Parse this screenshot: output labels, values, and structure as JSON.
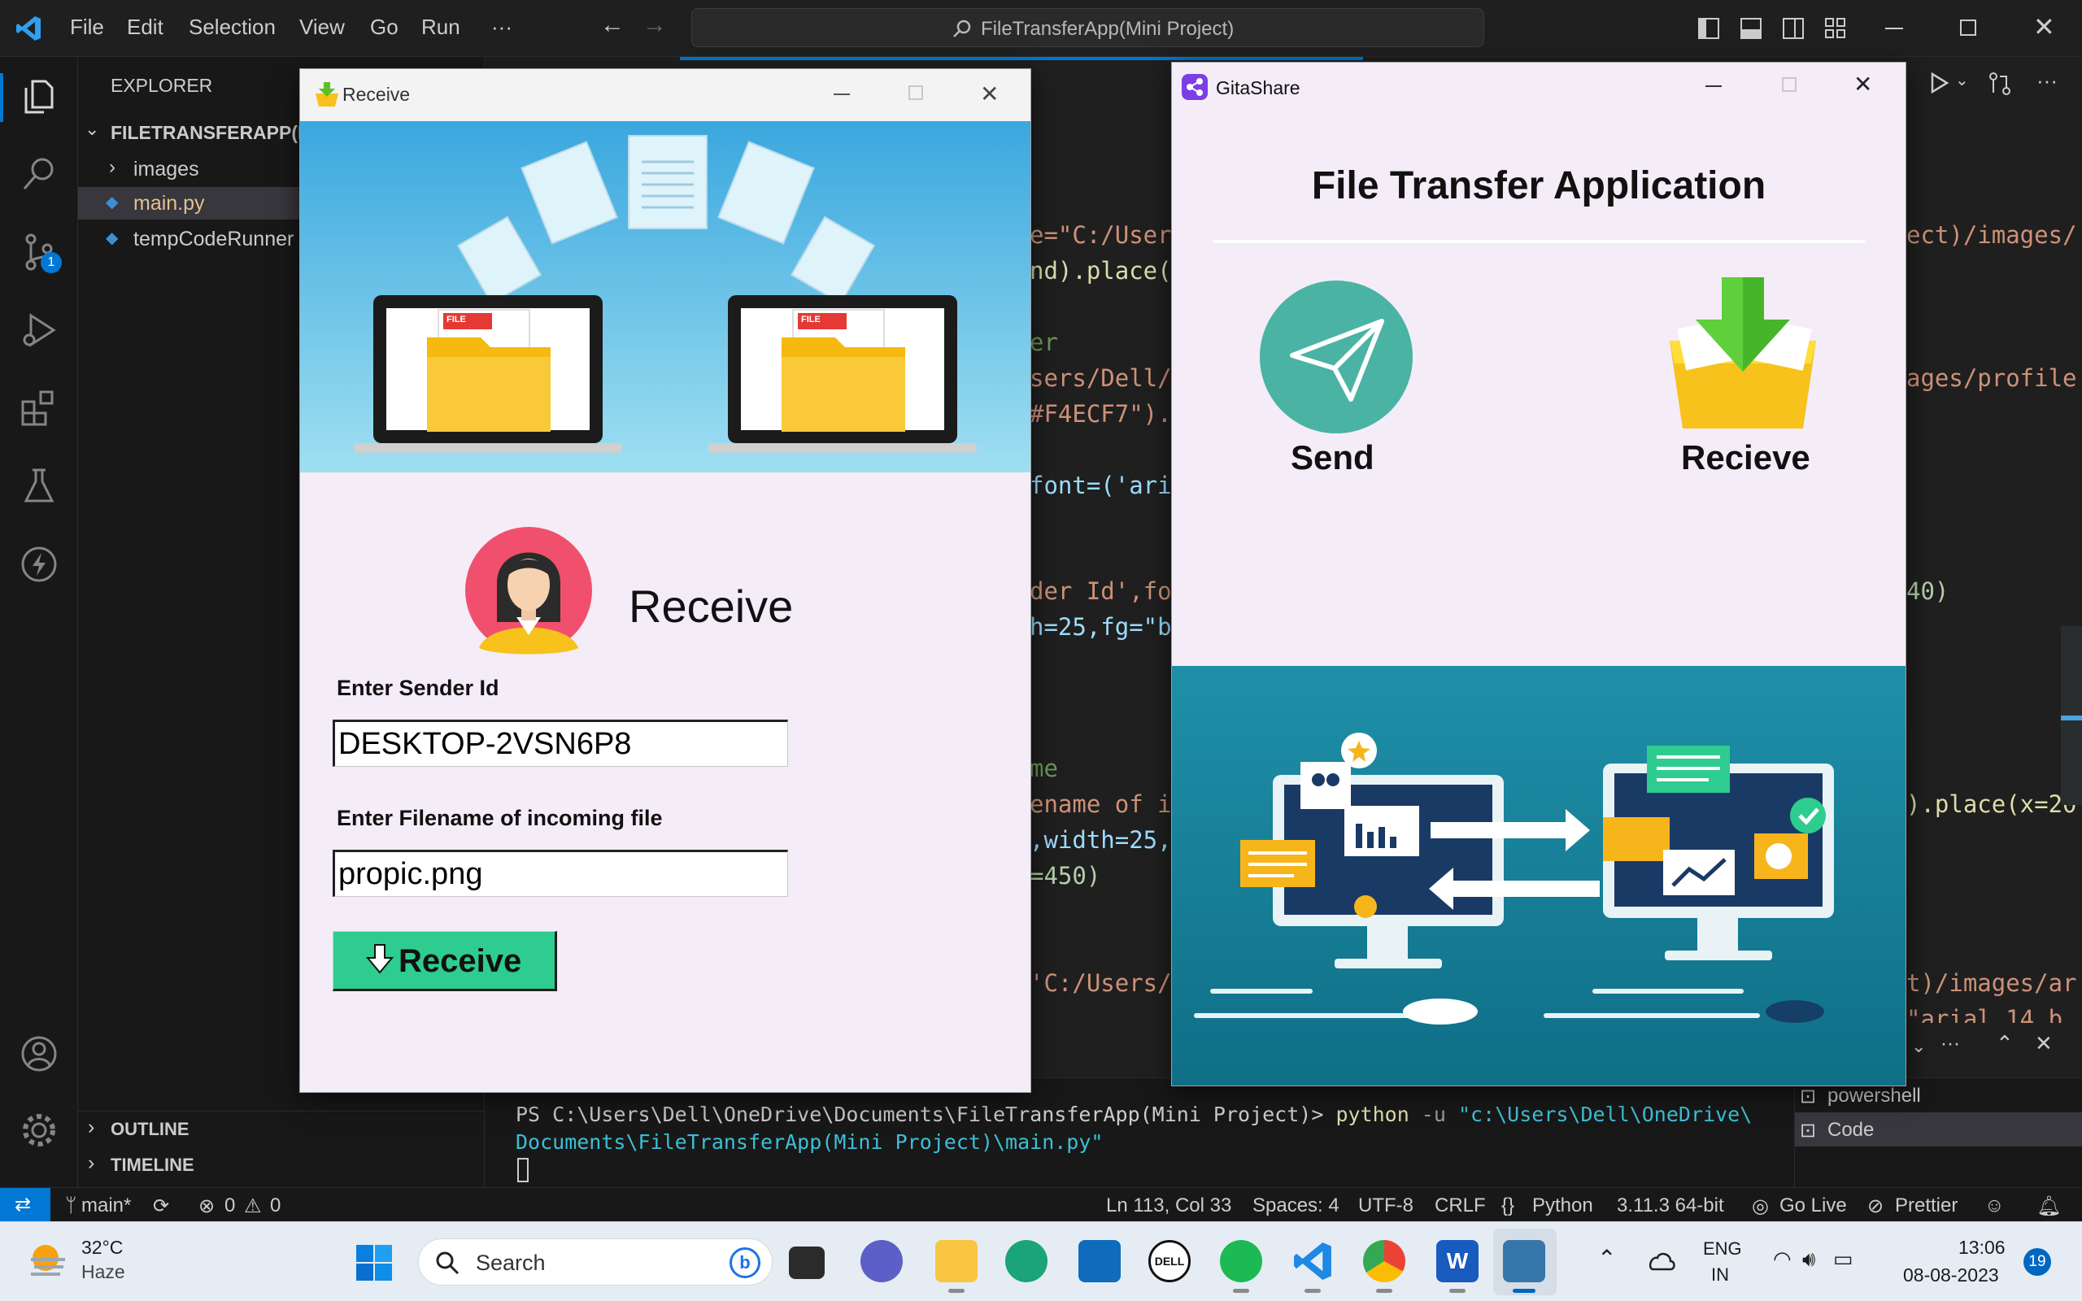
{
  "vscode": {
    "menu": [
      "File",
      "Edit",
      "Selection",
      "View",
      "Go",
      "Run",
      "···"
    ],
    "command_center": "FileTransferApp(Mini Project)",
    "activity_badge": "1",
    "explorer_label": "EXPLORER",
    "project_folder": "FILETRANSFERAPP(MI",
    "files": [
      "images",
      "main.py",
      "tempCodeRunner"
    ],
    "outline_label": "OUTLINE",
    "timeline_label": "TIMELINE",
    "code_fragments": {
      "l1a": "e=\"C:/User",
      "l1b": "ect)/images/",
      "l2": "nd).place(",
      "l3": "er",
      "l4a": "sers/Dell/",
      "l4b": "ages/profile",
      "l5": "#F4ECF7\").",
      "l6": "font=('ari",
      "l7a": "der Id',fo",
      "l7b": "40)",
      "l8": "h=25,fg=\"b",
      "l9": "me",
      "l10a": "ename of i",
      "l10b": ").place(x=20",
      "l11": ",width=25,",
      "l12": "=450)",
      "l13a": "'C:/Users/",
      "l13b": "t)/images/ar",
      "l14": "\"arial 14 b"
    },
    "terminal": {
      "line1_prompt": "PS C:\\Users\\Dell\\OneDrive\\Documents\\FileTransferApp(Mini Project)> ",
      "line1_cmd": "python",
      "line1_flag": " -u ",
      "line1_path": "\"c:\\Users\\Dell\\OneDrive\\",
      "line2_path": "Documents\\FileTransferApp(Mini Project)\\main.py\"",
      "shells": [
        "powershell",
        "Code"
      ]
    },
    "status": {
      "branch": "main*",
      "errors": "0",
      "warnings": "0",
      "position": "Ln 113, Col 33",
      "spaces": "Spaces: 4",
      "encoding": "UTF-8",
      "eol": "CRLF",
      "language": "Python",
      "interpreter": "3.11.3 64-bit",
      "golive": "Go Live",
      "prettier": "Prettier"
    }
  },
  "receive_window": {
    "title": "Receive",
    "heading": "Receive",
    "sender_label": "Enter Sender Id",
    "sender_value": "DESKTOP-2VSN6P8",
    "filename_label": "Enter Filename of incoming file",
    "filename_value": "propic.png",
    "button_label": "Receive",
    "file_tag": "FILE"
  },
  "gita_window": {
    "title": "GitaShare",
    "heading": "File Transfer Application",
    "send_label": "Send",
    "receive_label": "Recieve"
  },
  "taskbar": {
    "weather_temp": "32°C",
    "weather_desc": "Haze",
    "search_placeholder": "Search",
    "lang_top": "ENG",
    "lang_bottom": "IN",
    "time": "13:06",
    "date": "08-08-2023",
    "notifications": "19"
  },
  "colors": {
    "vscode_bg": "#1f1f1f",
    "window_bg": "#f4ecf7",
    "receive_button": "#2ecc8f",
    "send_circle": "#4bb3a3",
    "status_remote": "#0078d4"
  }
}
